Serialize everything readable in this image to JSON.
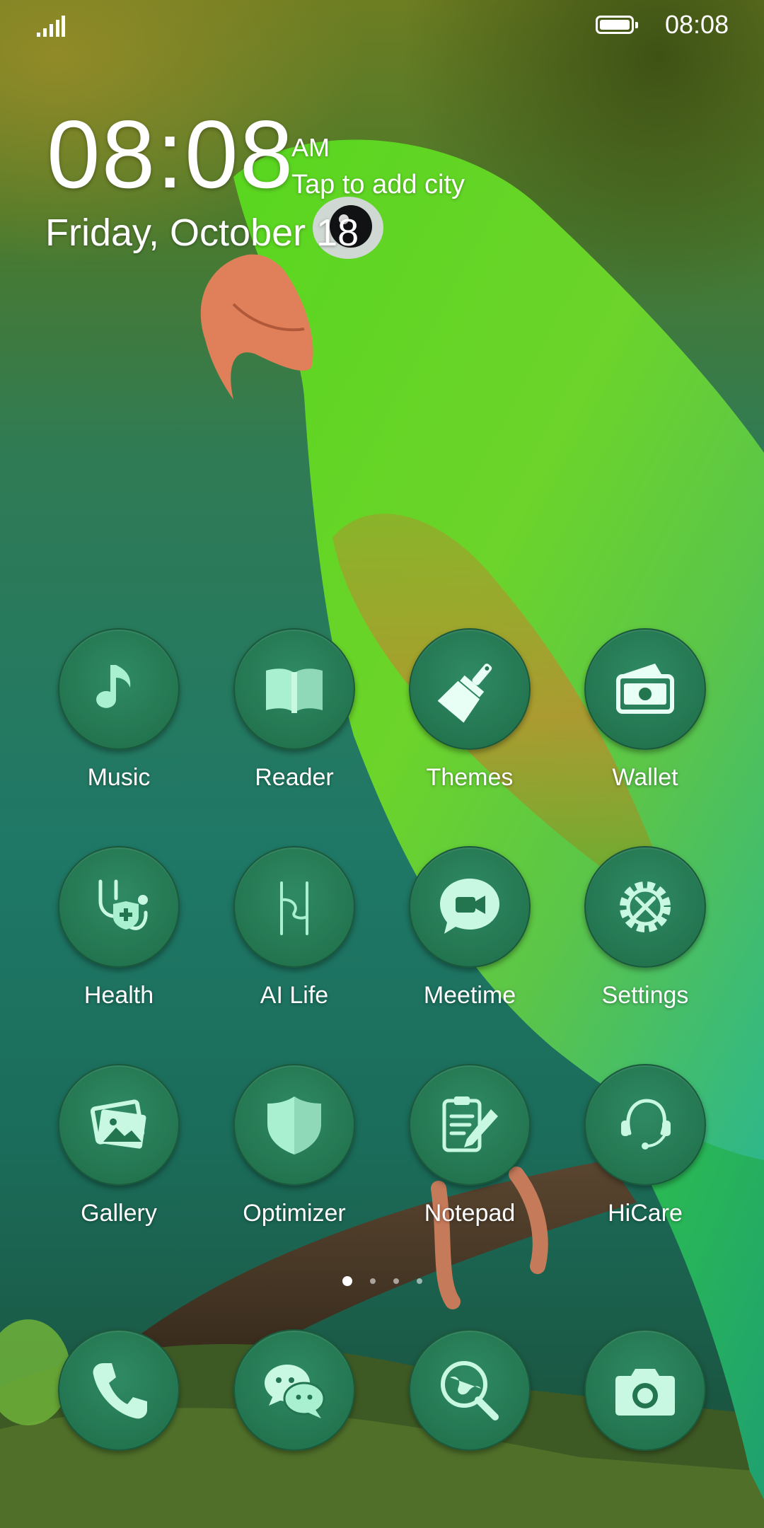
{
  "status_bar": {
    "signal_icon": "signal-icon",
    "battery_icon": "battery-icon",
    "time": "08:08"
  },
  "clock": {
    "time": "08:08",
    "ampm": "AM",
    "city_prompt": "Tap to add city",
    "date": "Friday, October 18"
  },
  "apps": [
    {
      "label": "Music",
      "icon": "music-note-icon"
    },
    {
      "label": "Reader",
      "icon": "book-icon"
    },
    {
      "label": "Themes",
      "icon": "paintbrush-icon"
    },
    {
      "label": "Wallet",
      "icon": "wallet-icon"
    },
    {
      "label": "Health",
      "icon": "stethoscope-icon"
    },
    {
      "label": "AI Life",
      "icon": "ai-life-icon"
    },
    {
      "label": "Meetime",
      "icon": "video-chat-icon"
    },
    {
      "label": "Settings",
      "icon": "gear-icon"
    },
    {
      "label": "Gallery",
      "icon": "photos-icon"
    },
    {
      "label": "Optimizer",
      "icon": "shield-icon"
    },
    {
      "label": "Notepad",
      "icon": "notepad-icon"
    },
    {
      "label": "HiCare",
      "icon": "headset-icon"
    }
  ],
  "page_indicator": {
    "total": 4,
    "current": 1
  },
  "dock": [
    {
      "icon": "phone-icon"
    },
    {
      "icon": "chat-bubbles-icon"
    },
    {
      "icon": "globe-search-icon"
    },
    {
      "icon": "camera-icon"
    }
  ]
}
